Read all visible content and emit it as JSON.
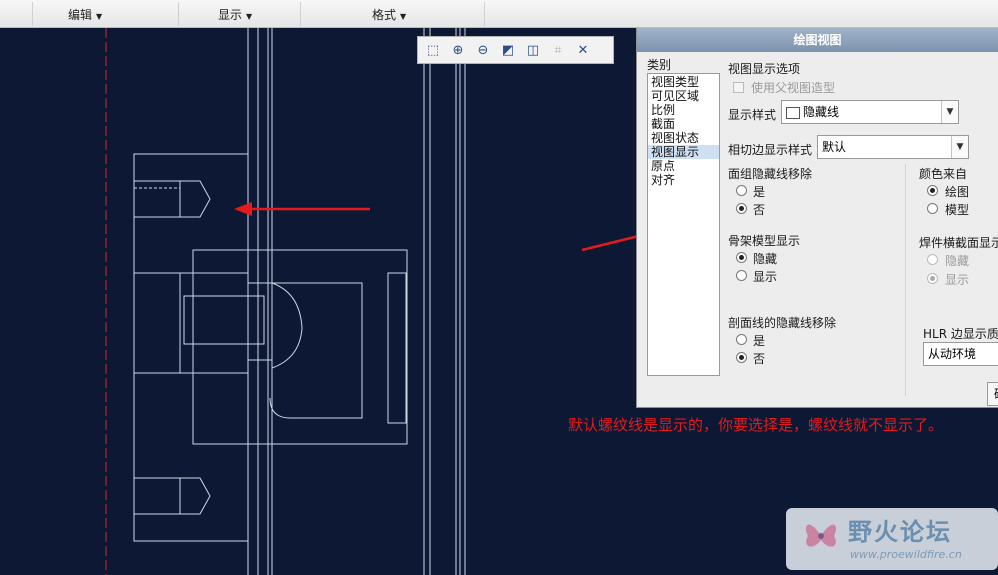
{
  "menubar": {
    "edit": "编辑",
    "display": "显示",
    "format": "格式"
  },
  "toolbar": {
    "icons": [
      "zoom-fit-icon",
      "zoom-in-icon",
      "zoom-out-icon",
      "repaint-icon",
      "display-style-icon",
      "annotation-display-icon",
      "datum-display-icon"
    ]
  },
  "dialog": {
    "title": "绘图视图",
    "category_label": "类别",
    "categories": [
      "视图类型",
      "可见区域",
      "比例",
      "截面",
      "视图状态",
      "视图显示",
      "原点",
      "对齐"
    ],
    "selected_category": "视图显示",
    "section_title": "视图显示选项",
    "use_parent": "使用父视图造型",
    "display_style_label": "显示样式",
    "display_style_value": "隐藏线",
    "tangent_label": "相切边显示样式",
    "tangent_value": "默认",
    "surface_hidden": {
      "label": "面组隐藏线移除",
      "yes": "是",
      "no": "否",
      "selected": "否"
    },
    "color_from": {
      "label": "颜色来自",
      "drawing": "绘图",
      "model": "模型",
      "selected": "绘图"
    },
    "skeleton": {
      "label": "骨架模型显示",
      "hide": "隐藏",
      "show": "显示",
      "selected": "隐藏"
    },
    "weld": {
      "label": "焊件横截面显示",
      "hide": "隐藏",
      "show": "显示",
      "selected": "显示"
    },
    "section_hidden": {
      "label": "剖面线的隐藏线移除",
      "yes": "是",
      "no": "否",
      "selected": "否"
    },
    "hlr_label": "HLR 边显示质量",
    "hlr_value": "从动环境",
    "button": "确"
  },
  "annotation": {
    "text": "默认螺纹线是显示的，你要选择是，螺纹线就不显示了。"
  },
  "watermark": {
    "title": "野火论坛",
    "url": "www.proewildfire.cn"
  },
  "colors": {
    "background": "#0d1835",
    "geometry": "#cfd6e6",
    "centerline": "#d02a2a",
    "arrow": "#e31b1b"
  }
}
